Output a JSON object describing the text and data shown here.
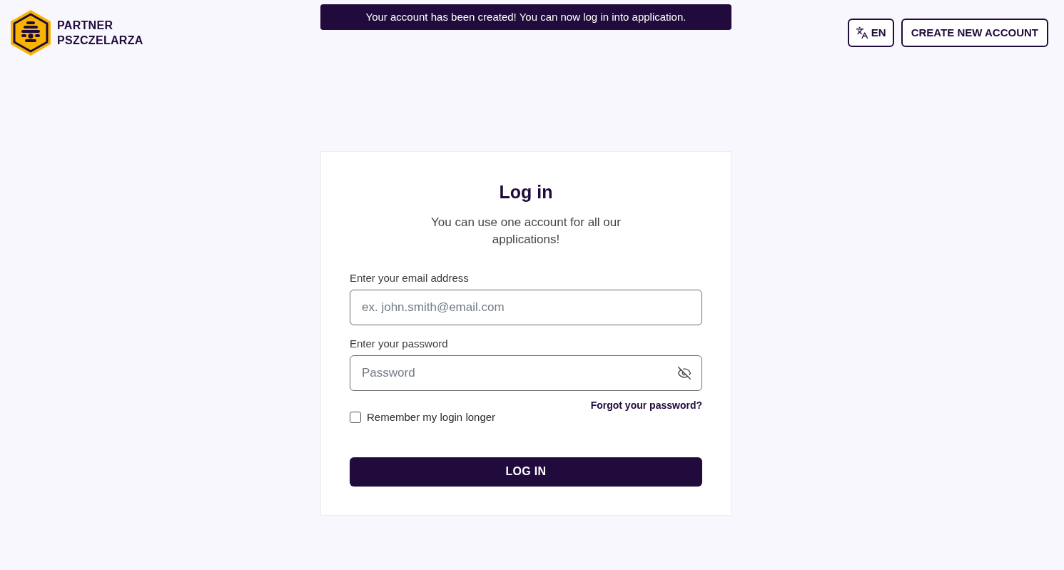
{
  "logo": {
    "line_1": "PARTNER",
    "line_2": "PSZCZELARZA"
  },
  "notification": {
    "message": "Your account has been created! You can now log in into application."
  },
  "header_actions": [
    {
      "kind": "language",
      "label": "EN"
    },
    {
      "kind": "text",
      "label": "CREATE NEW ACCOUNT"
    }
  ],
  "login_form": {
    "title": "Log in",
    "subtitle": "You can use one account for all our applications!",
    "fields": [
      {
        "kind": "email",
        "label": "Enter your email address",
        "placeholder": "ex. john.smith@email.com"
      },
      {
        "kind": "password",
        "label": "Enter your password",
        "placeholder": "Password",
        "show_password": false
      }
    ],
    "forgot_link": "Forgot your password?",
    "remember": {
      "label": "Remember my login longer",
      "checked": false
    },
    "submit": "LOG IN"
  }
}
